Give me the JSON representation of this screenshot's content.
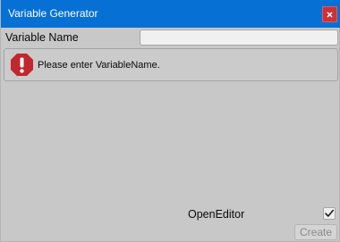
{
  "window": {
    "title": "Variable Generator",
    "close_icon": "close-icon"
  },
  "form": {
    "variable_name_label": "Variable Name",
    "variable_name_value": "",
    "variable_name_placeholder": ""
  },
  "helpbox": {
    "icon": "error-icon",
    "message": "Please enter VariableName."
  },
  "options": {
    "open_editor_label": "OpenEditor",
    "open_editor_checked": true
  },
  "actions": {
    "create_label": "Create",
    "create_enabled": false
  },
  "colors": {
    "titlebar": "#0670d4",
    "close_button": "#c8323a",
    "error_icon": "#c1272d",
    "window_background": "#c8c8c8"
  }
}
